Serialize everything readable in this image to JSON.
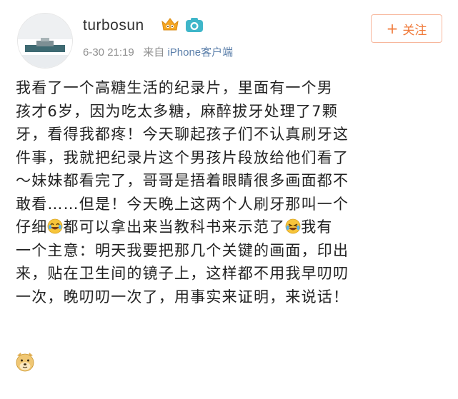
{
  "user": {
    "name": "turbosun",
    "badges": [
      "vip-crown-icon",
      "camera-icon"
    ]
  },
  "meta": {
    "time": "6-30 21:19",
    "from_prefix": "来自",
    "source": "iPhone客户端"
  },
  "follow": {
    "label": "关注",
    "icon": "plus-icon"
  },
  "post": {
    "lines": [
      "我看了一个高糖生活的纪录片，里面有一个男",
      "孩才6岁，因为吃太多糖，麻醉拔牙处理了7颗",
      "牙，看得我都疼！今天聊起孩子们不认真刷牙这",
      "件事，我就把纪录片这个男孩片段放给他们看了",
      "～妹妹都看完了，哥哥是捂着眼睛很多画面都不",
      "敢看……但是！今天晚上这两个人刷牙那叫一个"
    ],
    "line7_a": "仔细",
    "line7_b": "都可以拿出来当教科书来示范了",
    "line7_c": "我有",
    "line8": "一个主意：明天我要把那几个关键的画面，印出",
    "line9": "来，贴在卫生间的镜子上，这样都不用我早叨叨",
    "line10": "一次，晚叨叨一次了，用事实来证明，来说话！",
    "emojis": [
      "crying-laugh-icon",
      "laugh-tears-icon",
      "doge-icon"
    ]
  },
  "colors": {
    "accent": "#f07a3a",
    "link": "#5b7faa",
    "meta": "#8f8f8f",
    "text": "#222222"
  }
}
